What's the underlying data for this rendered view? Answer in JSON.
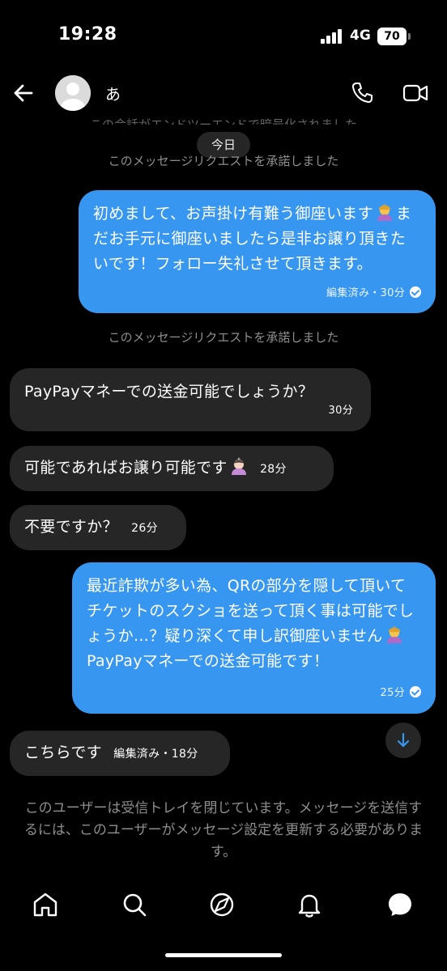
{
  "status": {
    "time": "19:28",
    "network": "4G",
    "battery": "70"
  },
  "header": {
    "contact_name": "あ",
    "icons": [
      "back-arrow-icon",
      "avatar",
      "phone-icon",
      "video-camera-icon"
    ]
  },
  "conversation": {
    "encryption_notice": "この会話がエンドツーエンドで暗号化されました",
    "date_label": "今日",
    "request_accepted_1": "このメッセージリクエストを承諾しました",
    "request_accepted_2": "このメッセージリクエストを承諾しました",
    "messages": [
      {
        "direction": "outgoing",
        "text_before_emoji": "初めまして、お声掛け有難う御座います",
        "emoji": "bowing-person-emoji",
        "text_after_emoji": "まだお手元に御座いましたら是非お譲り頂きたいです！フォロー失礼させて頂きます。",
        "meta": "編集済み・30分",
        "seen": true
      },
      {
        "direction": "incoming",
        "text": "PayPayマネーでの送金可能でしょうか？",
        "meta": "30分"
      },
      {
        "direction": "incoming",
        "text": "可能であればお譲り可能です",
        "emoji": "bowing-woman-emoji",
        "meta": "28分"
      },
      {
        "direction": "incoming",
        "text": "不要ですか？",
        "meta": "26分"
      },
      {
        "direction": "outgoing",
        "text_before_emoji": "最近詐欺が多い為、QRの部分を隠して頂いてチケットのスクショを送って頂く事は可能でしょうか…？疑り深くて申し訳御座いません",
        "emoji": "bowing-person-emoji",
        "text_after_emoji": "PayPayマネーでの送金可能です！",
        "meta": "25分",
        "seen": true
      },
      {
        "direction": "incoming",
        "text": "こちらです",
        "meta": "編集済み・18分"
      }
    ],
    "blocked_notice": "このユーザーは受信トレイを閉じています。メッセージを送信するには、このユーザーがメッセージ設定を更新する必要があります。"
  },
  "bottom_nav": {
    "items": [
      "home-icon",
      "search-icon",
      "explore-icon",
      "notifications-bell-icon",
      "messages-icon"
    ]
  },
  "colors": {
    "background": "#000000",
    "outgoing_bubble": "#3797f0",
    "incoming_bubble": "#262626",
    "system_text": "#8e8e8e"
  }
}
